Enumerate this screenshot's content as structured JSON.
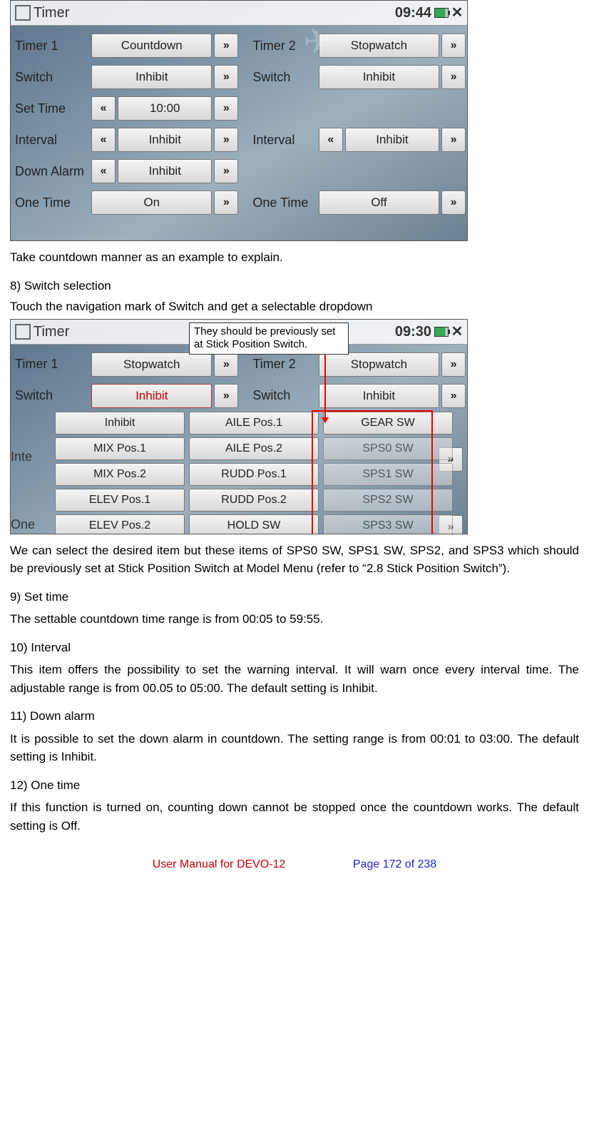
{
  "screenshot1": {
    "title": "Timer",
    "clock": "09:44",
    "rows": {
      "timer1": {
        "label": "Timer 1",
        "value": "Countdown"
      },
      "timer2": {
        "label": "Timer 2",
        "value": "Stopwatch"
      },
      "switch1": {
        "label": "Switch",
        "value": "Inhibit"
      },
      "switch2": {
        "label": "Switch",
        "value": "Inhibit"
      },
      "settime": {
        "label": "Set Time",
        "value": "10:00"
      },
      "interval1": {
        "label": "Interval",
        "value": "Inhibit"
      },
      "interval2": {
        "label": "Interval",
        "value": "Inhibit"
      },
      "downalarm": {
        "label": "Down Alarm",
        "value": "Inhibit"
      },
      "onetime1": {
        "label": "One Time",
        "value": "On"
      },
      "onetime2": {
        "label": "One Time",
        "value": "Off"
      }
    }
  },
  "para_intro": "Take countdown manner as an example to explain.",
  "sect8_title": "8)   Switch selection",
  "sect8_para": "Touch the navigation mark of Switch and get a selectable dropdown",
  "screenshot2": {
    "title": "Timer",
    "clock": "09:30",
    "callout": "They should be previously set at Stick Position Switch.",
    "rows": {
      "timer1": {
        "label": "Timer 1",
        "value": "Stopwatch"
      },
      "timer2": {
        "label": "Timer 2",
        "value": "Stopwatch"
      },
      "switch1": {
        "label": "Switch",
        "value": "Inhibit"
      },
      "switch2": {
        "label": "Switch",
        "value": "Inhibit"
      },
      "inte": {
        "label": "Inte"
      },
      "one": {
        "label": "One"
      }
    },
    "options": [
      "Inhibit",
      "AILE Pos.1",
      "GEAR SW",
      "MIX Pos.1",
      "AILE Pos.2",
      "SPS0 SW",
      "MIX Pos.2",
      "RUDD Pos.1",
      "SPS1 SW",
      "ELEV Pos.1",
      "RUDD Pos.2",
      "SPS2 SW",
      "ELEV Pos.2",
      "HOLD SW",
      "SPS3 SW"
    ]
  },
  "sect8_after": "We can select the desired item but these items of SPS0 SW, SPS1 SW, SPS2, and SPS3 which should be previously set at Stick Position Switch at Model Menu (refer to “2.8 Stick Position Switch”).",
  "sect9_title": "9)   Set time",
  "sect9_para": "The settable countdown time range is from 00:05 to 59:55.",
  "sect10_title": "10) Interval",
  "sect10_para": "This item offers the possibility to set the warning interval. It will warn once every interval time. The adjustable range is from 00.05 to 05:00. The default setting is Inhibit.",
  "sect11_title": "11) Down alarm",
  "sect11_para": "It is possible to set the down alarm in countdown. The setting range is from 00:01 to 03:00. The default setting is Inhibit.",
  "sect12_title": "12) One time",
  "sect12_para": "If this function is turned on, counting down cannot be stopped once the countdown works. The default setting is Off.",
  "footer": {
    "manual": "User Manual for DEVO-12",
    "page": "Page 172 of 238"
  },
  "glyphs": {
    "left": "«",
    "right": "»"
  }
}
